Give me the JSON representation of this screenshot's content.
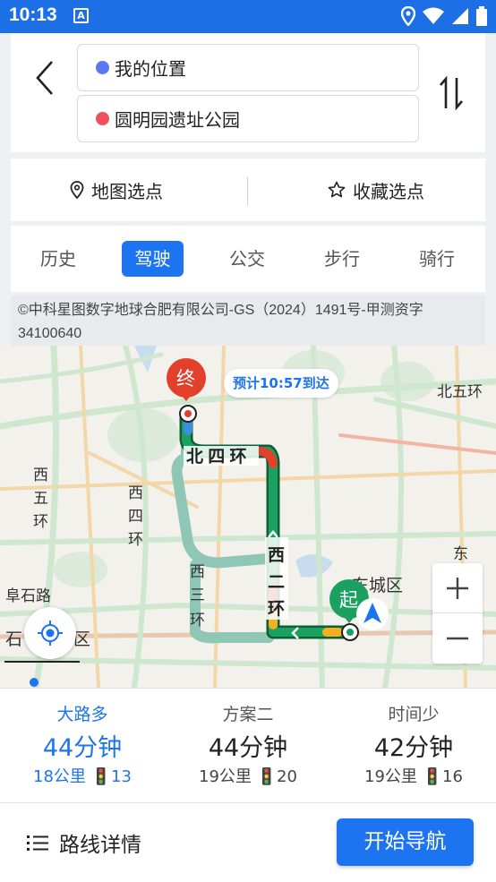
{
  "status_bar": {
    "time": "10:13",
    "left_icon": "A"
  },
  "route_search": {
    "from_text": "我的位置",
    "to_text": "圆明园遗址公园",
    "from_dot_color": "#5a78f0",
    "to_dot_color": "#f0505a"
  },
  "pick_bar": {
    "map_pick": "地图选点",
    "fav_pick": "收藏选点"
  },
  "mode_tabs": [
    {
      "label": "历史",
      "active": false
    },
    {
      "label": "驾驶",
      "active": true
    },
    {
      "label": "公交",
      "active": false
    },
    {
      "label": "步行",
      "active": false
    },
    {
      "label": "骑行",
      "active": false
    }
  ],
  "copyright": "©中科星图数字地球合肥有限公司-GS（2024）1491号-甲测资字34100640",
  "map": {
    "eta": "预计10:57到达",
    "end_label": "终",
    "start_label": "起",
    "road_labels": {
      "north4": "北 四 环",
      "west2": "西\n二\n环",
      "west3": "西\n三\n环",
      "west4": "西\n四\n环",
      "west5": "西\n五\n环",
      "fushilu": "阜石路",
      "dongcheng": "东城区",
      "north5": "北五环",
      "east": "东",
      "shi": "石",
      "qu": "区"
    }
  },
  "routes": [
    {
      "name": "大路多",
      "time": "44分钟",
      "info": "18公里 🚦13",
      "selected": true
    },
    {
      "name": "方案二",
      "time": "44分钟",
      "info": "19公里 🚦20",
      "selected": false
    },
    {
      "name": "时间少",
      "time": "42分钟",
      "info": "19公里 🚦16",
      "selected": false
    }
  ],
  "bottom": {
    "details": "路线详情",
    "start_nav": "开始导航"
  },
  "colors": {
    "accent": "#1d74f0",
    "traffic_green": "#1aa160",
    "route_alt": "#8fc6b6"
  }
}
